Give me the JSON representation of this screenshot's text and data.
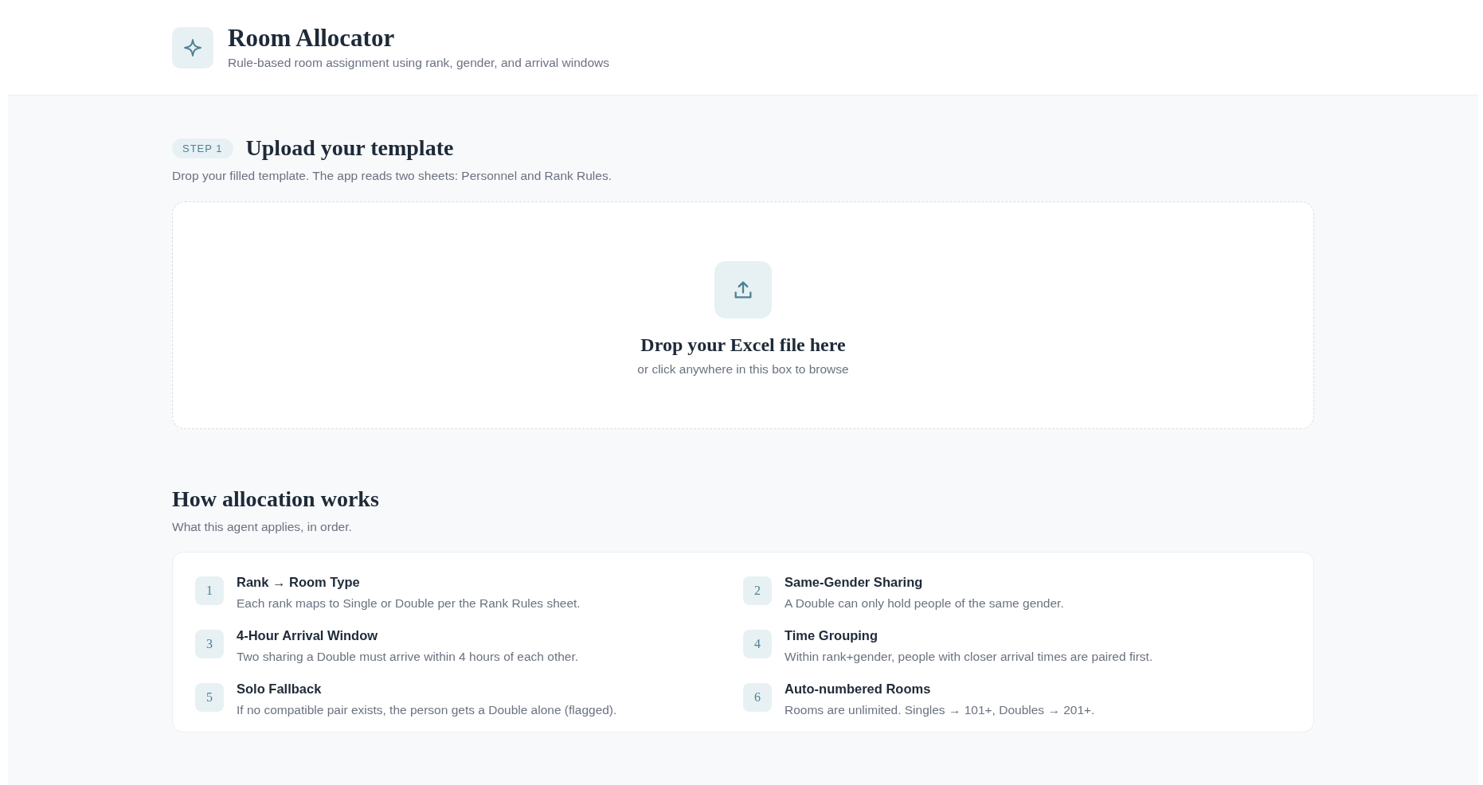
{
  "header": {
    "title": "Room Allocator",
    "subtitle": "Rule-based room assignment using rank, gender, and arrival windows"
  },
  "upload": {
    "step": "STEP 1",
    "title": "Upload your template",
    "description": "Drop your filled template. The app reads two sheets: Personnel and Rank Rules.",
    "dropzone": {
      "title": "Drop your Excel file here",
      "hint": "or click anywhere in this box to browse"
    }
  },
  "rules": {
    "title": "How allocation works",
    "description": "What this agent applies, in order.",
    "items": [
      {
        "number": "1",
        "title": "Rank → Room Type",
        "text": "Each rank maps to Single or Double per the Rank Rules sheet."
      },
      {
        "number": "2",
        "title": "Same-Gender Sharing",
        "text": "A Double can only hold people of the same gender."
      },
      {
        "number": "3",
        "title": "4-Hour Arrival Window",
        "text": "Two sharing a Double must arrive within 4 hours of each other."
      },
      {
        "number": "4",
        "title": "Time Grouping",
        "text": "Within rank+gender, people with closer arrival times are paired first."
      },
      {
        "number": "5",
        "title": "Solo Fallback",
        "text": "If no compatible pair exists, the person gets a Double alone (flagged)."
      },
      {
        "number": "6",
        "title": "Auto-numbered Rooms",
        "text": "Rooms are unlimited. Singles → 101+, Doubles → 201+."
      }
    ]
  }
}
